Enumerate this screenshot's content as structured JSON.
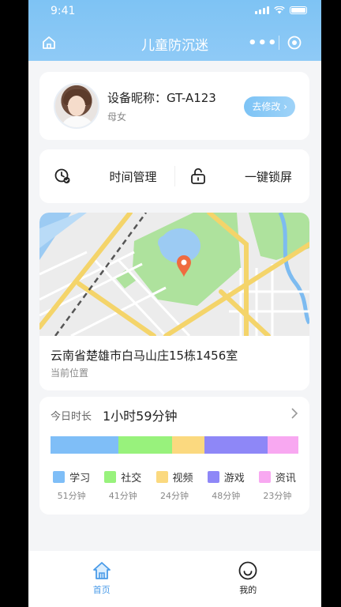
{
  "status_bar": {
    "time": "9:41"
  },
  "nav": {
    "title": "儿童防沉迷",
    "more": "•••"
  },
  "device": {
    "nickname": "设备昵称：GT-A123",
    "role": "母女",
    "edit_label": "去修改",
    "edit_chevron": "›"
  },
  "actions": [
    {
      "label": "时间管理",
      "icon": "clock-check-icon"
    },
    {
      "label": "一键锁屏",
      "icon": "unlock-icon"
    }
  ],
  "location": {
    "address": "云南省楚雄市白马山庄15栋1456室",
    "caption": "当前位置"
  },
  "usage": {
    "today_label": "今日时长",
    "today_value": "1小时59分钟",
    "categories": [
      {
        "name": "学习",
        "minutes_label": "51分钟",
        "minutes": 51,
        "color": "#7fbef7"
      },
      {
        "name": "社交",
        "minutes_label": "41分钟",
        "minutes": 41,
        "color": "#98f27c"
      },
      {
        "name": "视频",
        "minutes_label": "24分钟",
        "minutes": 24,
        "color": "#fbd97f"
      },
      {
        "name": "游戏",
        "minutes_label": "48分钟",
        "minutes": 48,
        "color": "#8e87f7"
      },
      {
        "name": "资讯",
        "minutes_label": "23分钟",
        "minutes": 23,
        "color": "#f8a8f1"
      }
    ]
  },
  "tabbar": [
    {
      "label": "首页",
      "icon": "home-icon",
      "active": true,
      "color": "#4a9be8"
    },
    {
      "label": "我的",
      "icon": "smile-icon",
      "active": false,
      "color": "#222222"
    }
  ]
}
